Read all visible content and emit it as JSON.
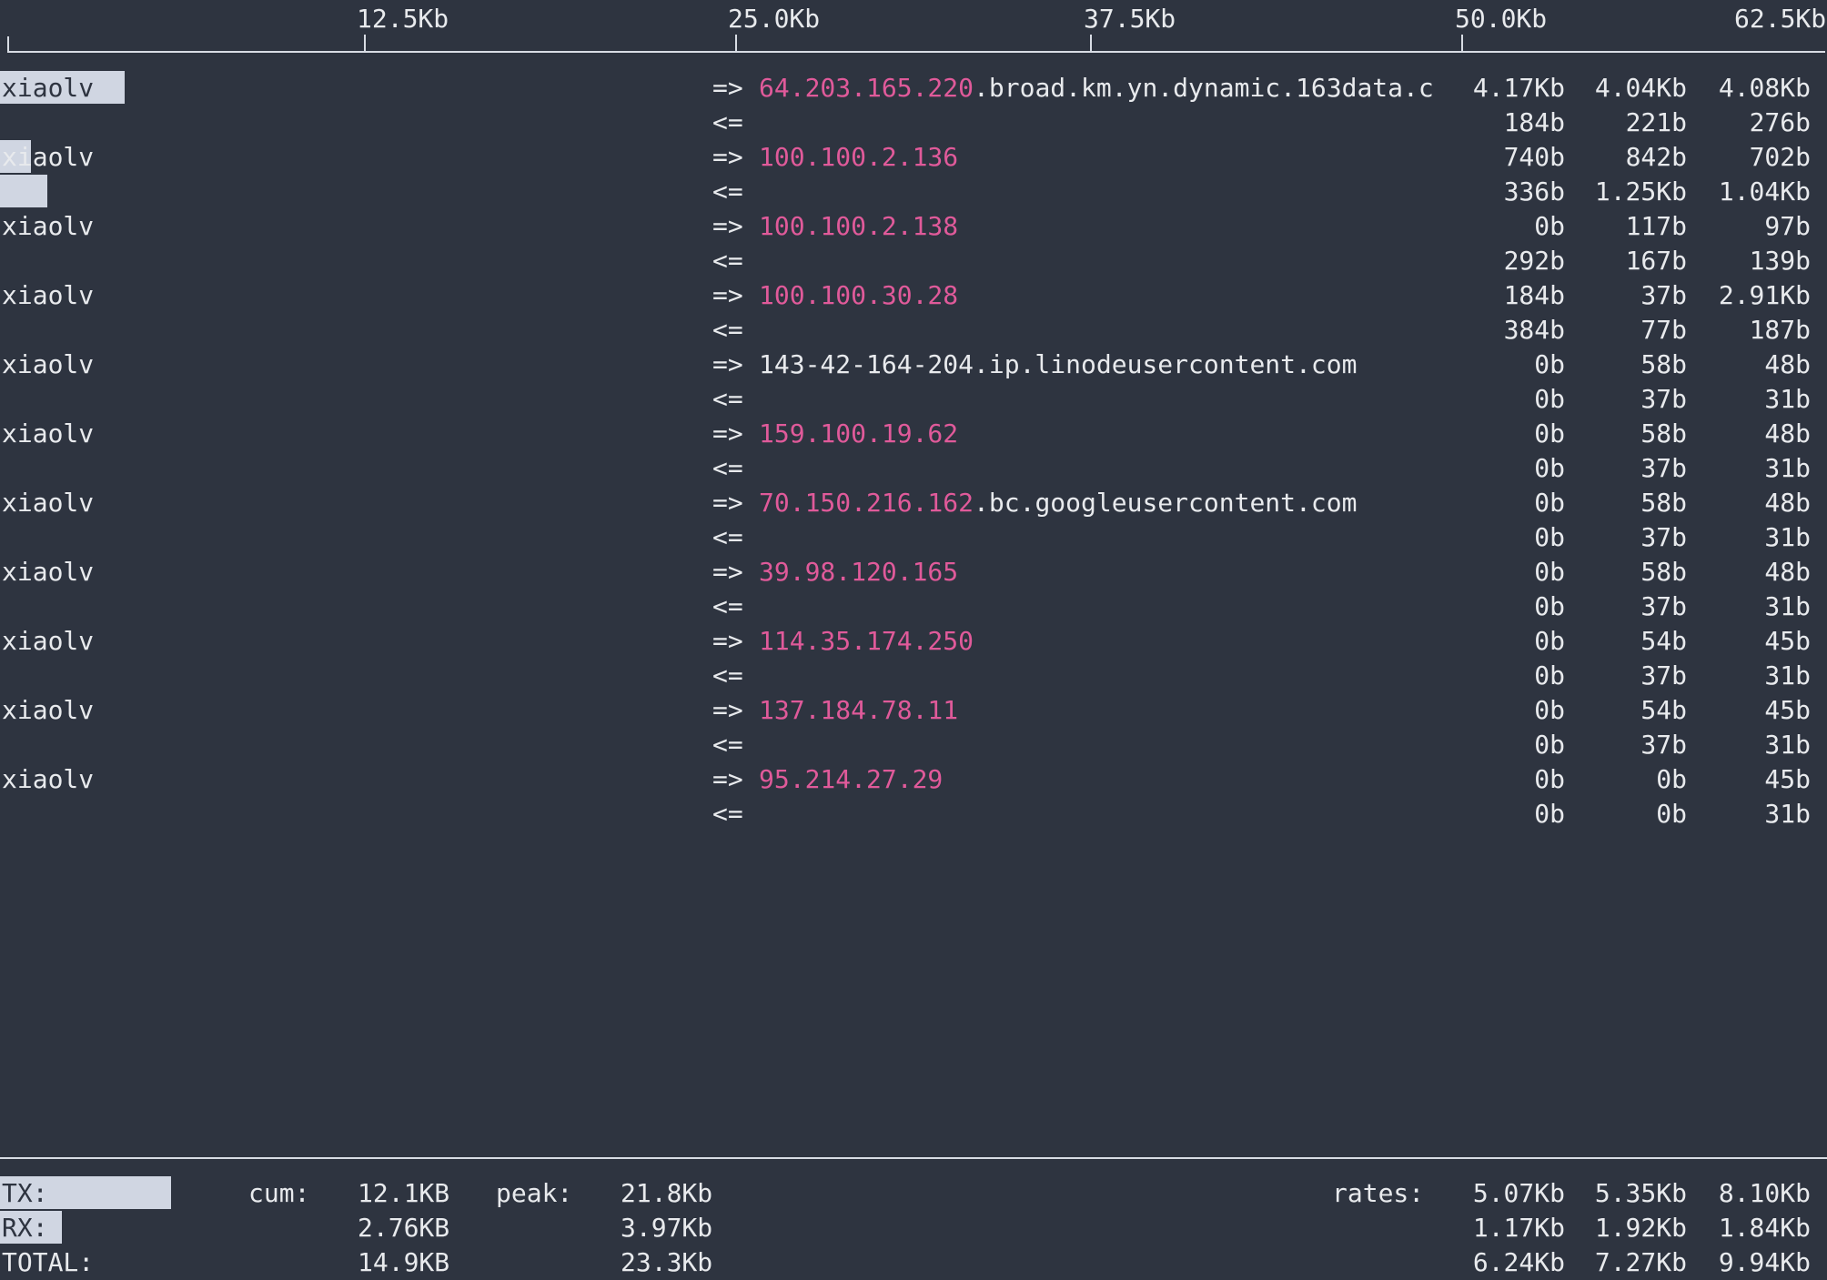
{
  "scale": {
    "ticks": [
      "12.5Kb",
      "25.0Kb",
      "37.5Kb",
      "50.0Kb",
      "62.5Kb"
    ]
  },
  "connections": [
    {
      "host": "xiaolv",
      "remote_ip": "64.203.165.220",
      "remote_suffix": ".broad.km.yn.dynamic.163data.c",
      "out_arrow": "=>",
      "in_arrow": "<=",
      "tx": [
        "4.17Kb",
        "4.04Kb",
        "4.08Kb"
      ],
      "rx": [
        "184b",
        "221b",
        "276b"
      ]
    },
    {
      "host": "xiaolv",
      "remote_ip": "100.100.2.136",
      "remote_suffix": "",
      "out_arrow": "=>",
      "in_arrow": "<=",
      "tx": [
        "740b",
        "842b",
        "702b"
      ],
      "rx": [
        "336b",
        "1.25Kb",
        "1.04Kb"
      ]
    },
    {
      "host": "xiaolv",
      "remote_ip": "100.100.2.138",
      "remote_suffix": "",
      "out_arrow": "=>",
      "in_arrow": "<=",
      "tx": [
        "0b",
        "117b",
        "97b"
      ],
      "rx": [
        "292b",
        "167b",
        "139b"
      ]
    },
    {
      "host": "xiaolv",
      "remote_ip": "100.100.30.28",
      "remote_suffix": "",
      "out_arrow": "=>",
      "in_arrow": "<=",
      "tx": [
        "184b",
        "37b",
        "2.91Kb"
      ],
      "rx": [
        "384b",
        "77b",
        "187b"
      ]
    },
    {
      "host": "xiaolv",
      "remote_ip": "",
      "remote_suffix": "143-42-164-204.ip.linodeusercontent.com",
      "out_arrow": "=>",
      "in_arrow": "<=",
      "tx": [
        "0b",
        "58b",
        "48b"
      ],
      "rx": [
        "0b",
        "37b",
        "31b"
      ]
    },
    {
      "host": "xiaolv",
      "remote_ip": "159.100.19.62",
      "remote_suffix": "",
      "out_arrow": "=>",
      "in_arrow": "<=",
      "tx": [
        "0b",
        "58b",
        "48b"
      ],
      "rx": [
        "0b",
        "37b",
        "31b"
      ]
    },
    {
      "host": "xiaolv",
      "remote_ip": "70.150.216.162",
      "remote_suffix": ".bc.googleusercontent.com",
      "out_arrow": "=>",
      "in_arrow": "<=",
      "tx": [
        "0b",
        "58b",
        "48b"
      ],
      "rx": [
        "0b",
        "37b",
        "31b"
      ]
    },
    {
      "host": "xiaolv",
      "remote_ip": "39.98.120.165",
      "remote_suffix": "",
      "out_arrow": "=>",
      "in_arrow": "<=",
      "tx": [
        "0b",
        "58b",
        "48b"
      ],
      "rx": [
        "0b",
        "37b",
        "31b"
      ]
    },
    {
      "host": "xiaolv",
      "remote_ip": "114.35.174.250",
      "remote_suffix": "",
      "out_arrow": "=>",
      "in_arrow": "<=",
      "tx": [
        "0b",
        "54b",
        "45b"
      ],
      "rx": [
        "0b",
        "37b",
        "31b"
      ]
    },
    {
      "host": "xiaolv",
      "remote_ip": "137.184.78.11",
      "remote_suffix": "",
      "out_arrow": "=>",
      "in_arrow": "<=",
      "tx": [
        "0b",
        "54b",
        "45b"
      ],
      "rx": [
        "0b",
        "37b",
        "31b"
      ]
    },
    {
      "host": "xiaolv",
      "remote_ip": "95.214.27.29",
      "remote_suffix": "",
      "out_arrow": "=>",
      "in_arrow": "<=",
      "tx": [
        "0b",
        "0b",
        "45b"
      ],
      "rx": [
        "0b",
        "0b",
        "31b"
      ]
    }
  ],
  "footer": {
    "tx_label": "TX:",
    "rx_label": "RX:",
    "total_label": "TOTAL:",
    "cum_label": "cum:",
    "peak_label": "peak:",
    "rates_label": "rates:",
    "cum": {
      "tx": "12.1KB",
      "rx": "2.76KB",
      "total": "14.9KB"
    },
    "peak": {
      "tx": "21.8Kb",
      "rx": "3.97Kb",
      "total": "23.3Kb"
    },
    "rates": {
      "tx": [
        "5.07Kb",
        "5.35Kb",
        "8.10Kb"
      ],
      "rx": [
        "1.17Kb",
        "1.92Kb",
        "1.84Kb"
      ],
      "total": [
        "6.24Kb",
        "7.27Kb",
        "9.94Kb"
      ]
    }
  },
  "colors": {
    "background": "#2e3440",
    "text": "#e8eaed",
    "ip_highlight": "#e05a9a",
    "bar_fill": "#d0d6e2"
  }
}
